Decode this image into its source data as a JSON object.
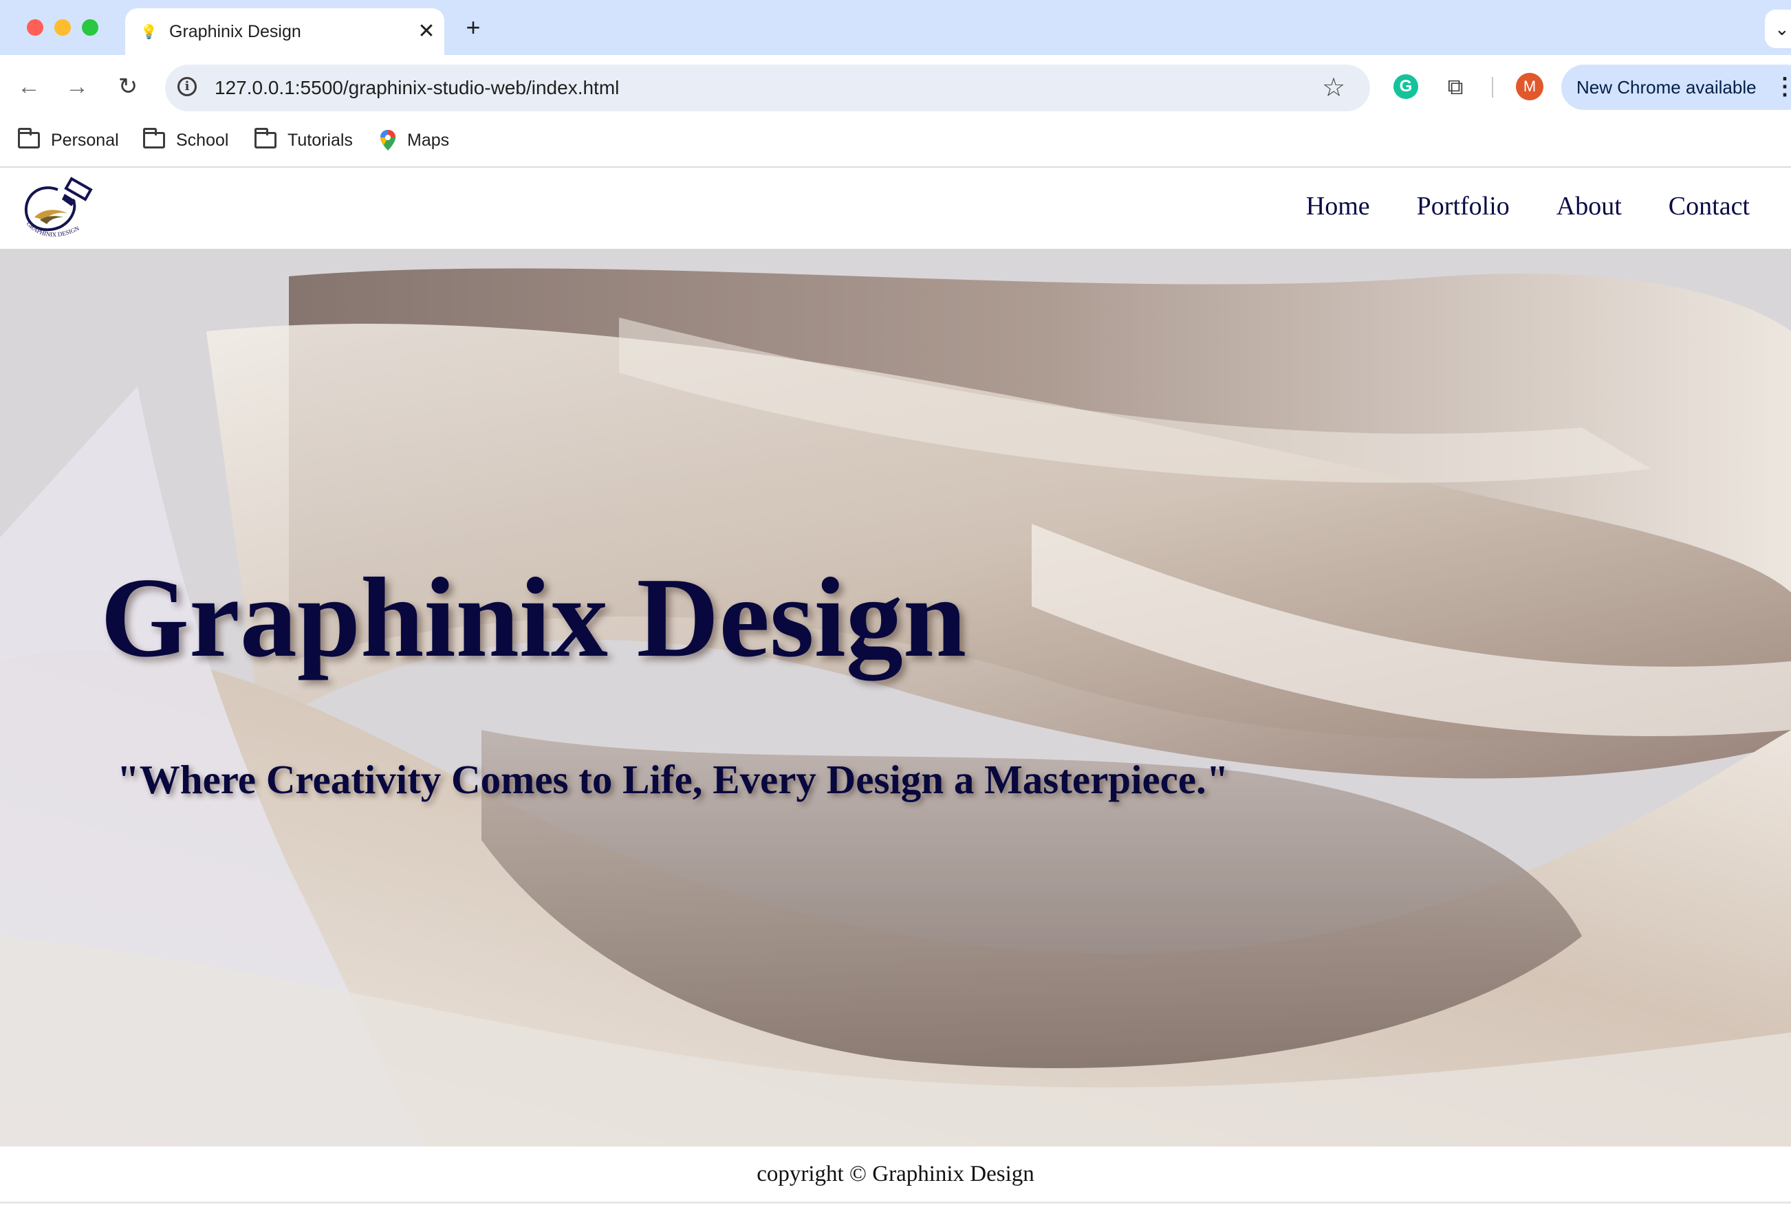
{
  "browser": {
    "tab_title": "Graphinix Design",
    "tab_close": "✕",
    "new_tab": "+",
    "url": "127.0.0.1:5500/graphinix-studio-web/index.html",
    "profile_initial": "M",
    "update_label": "New Chrome available",
    "bookmarks": [
      "Personal",
      "School",
      "Tutorials",
      "Maps"
    ]
  },
  "site": {
    "nav": [
      "Home",
      "Portfolio",
      "About",
      "Contact"
    ],
    "hero_title": "Graphinix Design",
    "tagline": "\"Where Creativity Comes to Life, Every Design a Masterpiece.\"",
    "footer": "copyright © Graphinix Design",
    "logo_text": "GRAPHINIX DESIGN",
    "colors": {
      "text": "#08083e",
      "tab_strip": "#d3e3fd",
      "avatar": "#e0582b"
    }
  }
}
